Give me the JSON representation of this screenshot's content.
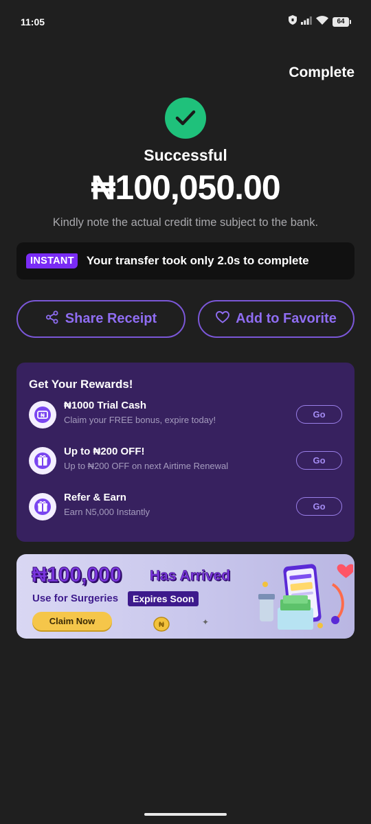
{
  "status_bar": {
    "time": "11:05",
    "battery": "64"
  },
  "header": {
    "complete_label": "Complete"
  },
  "result": {
    "title": "Successful",
    "amount": "₦100,050.00",
    "note": "Kindly note the actual credit time subject to the bank."
  },
  "instant": {
    "badge": "INSTANT",
    "text": "Your transfer took only 2.0s to complete"
  },
  "actions": {
    "share_label": "Share Receipt",
    "favorite_label": "Add to Favorite"
  },
  "rewards": {
    "title": "Get Your Rewards!",
    "items": [
      {
        "title": "₦1000 Trial Cash",
        "subtitle": "Claim your FREE bonus, expire today!",
        "button": "Go",
        "icon": "cash-coupon-icon"
      },
      {
        "title": "Up to ₦200 OFF!",
        "subtitle": "Up to ₦200 OFF on next Airtime Renewal",
        "button": "Go",
        "icon": "gift-box-icon"
      },
      {
        "title": "Refer & Earn",
        "subtitle": "Earn N5,000 Instantly",
        "button": "Go",
        "icon": "gift-box-icon"
      }
    ]
  },
  "banner": {
    "amount": "₦100,000",
    "arrived": "Has Arrived",
    "use_text": "Use for Surgeries",
    "expires": "Expires Soon",
    "claim_label": "Claim Now"
  },
  "colors": {
    "background": "#1f1f1f",
    "success_green": "#1fc17b",
    "accent_purple": "#7b57d8",
    "rewards_bg": "#37215f",
    "instant_badge": "#7a2cf5"
  }
}
